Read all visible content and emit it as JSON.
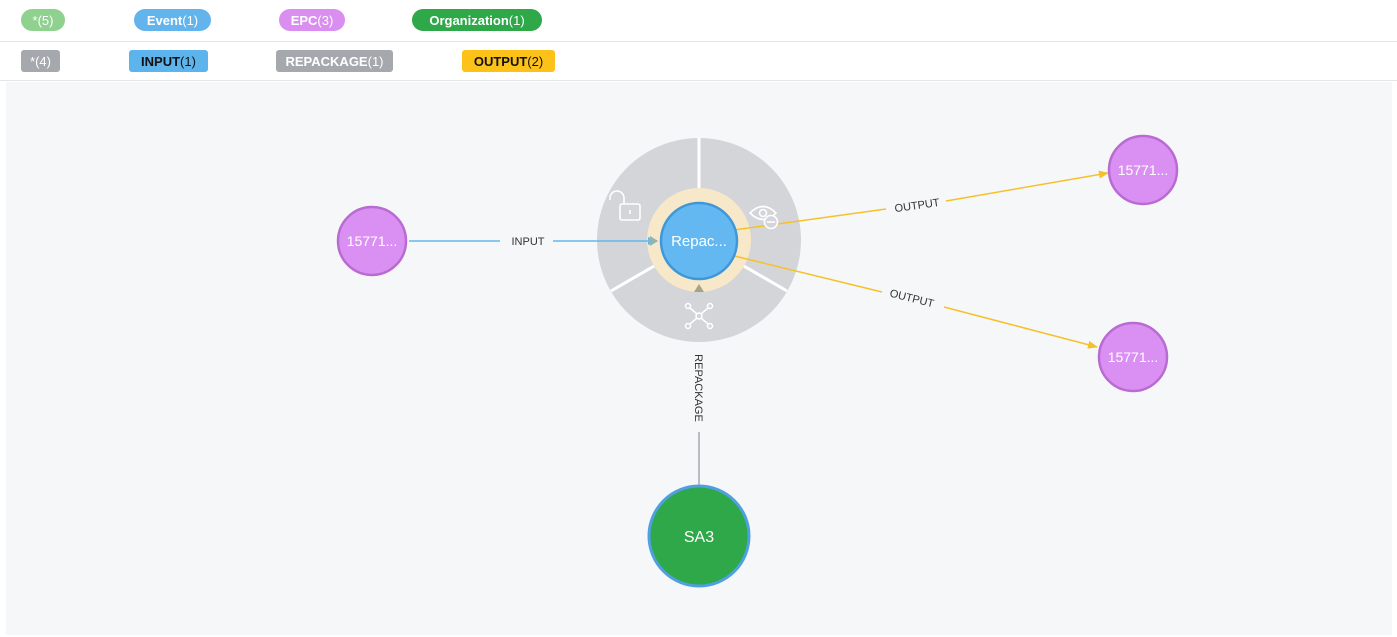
{
  "node_legend": [
    {
      "label": "*",
      "count": "(5)",
      "color": "#8fd18f"
    },
    {
      "label": "Event",
      "count": "(1)",
      "color": "#63b3ed"
    },
    {
      "label": "EPC",
      "count": "(3)",
      "color": "#da8ef0"
    },
    {
      "label": "Organization",
      "count": "(1)",
      "color": "#2fa84a"
    }
  ],
  "relationship_legend": [
    {
      "label": "*",
      "count": "(4)",
      "color": "#a5a8ad",
      "text_color": "#ffffff"
    },
    {
      "label": "INPUT",
      "count": "(1)",
      "color": "#5db3ec",
      "text_color": "#111111"
    },
    {
      "label": "REPACKAGE",
      "count": "(1)",
      "color": "#a5a8ad",
      "text_color": "#ffffff"
    },
    {
      "label": "OUTPUT",
      "count": "(2)",
      "color": "#fdc21a",
      "text_color": "#111111"
    }
  ],
  "graph": {
    "nodes": {
      "event": {
        "label": "Repac...",
        "color": "#63b8f2"
      },
      "epc_input": {
        "label": "15771...",
        "color": "#da90f2"
      },
      "epc_output_1": {
        "label": "15771...",
        "color": "#da90f2"
      },
      "epc_output_2": {
        "label": "15771...",
        "color": "#da90f2"
      },
      "organization": {
        "label": "SA3",
        "color": "#2fa84a"
      }
    },
    "edges": {
      "input": {
        "label": "INPUT",
        "color": "#63b8ec"
      },
      "output_1": {
        "label": "OUTPUT",
        "color": "#f5c12a"
      },
      "output_2": {
        "label": "OUTPUT",
        "color": "#f5c12a"
      },
      "repackage": {
        "label": "REPACKAGE",
        "color": "#a5a8ad"
      }
    },
    "ring_menu": {
      "unlock_icon": "lock-open-icon",
      "hide_icon": "eye-hide-icon",
      "expand_icon": "graph-expand-icon"
    }
  }
}
